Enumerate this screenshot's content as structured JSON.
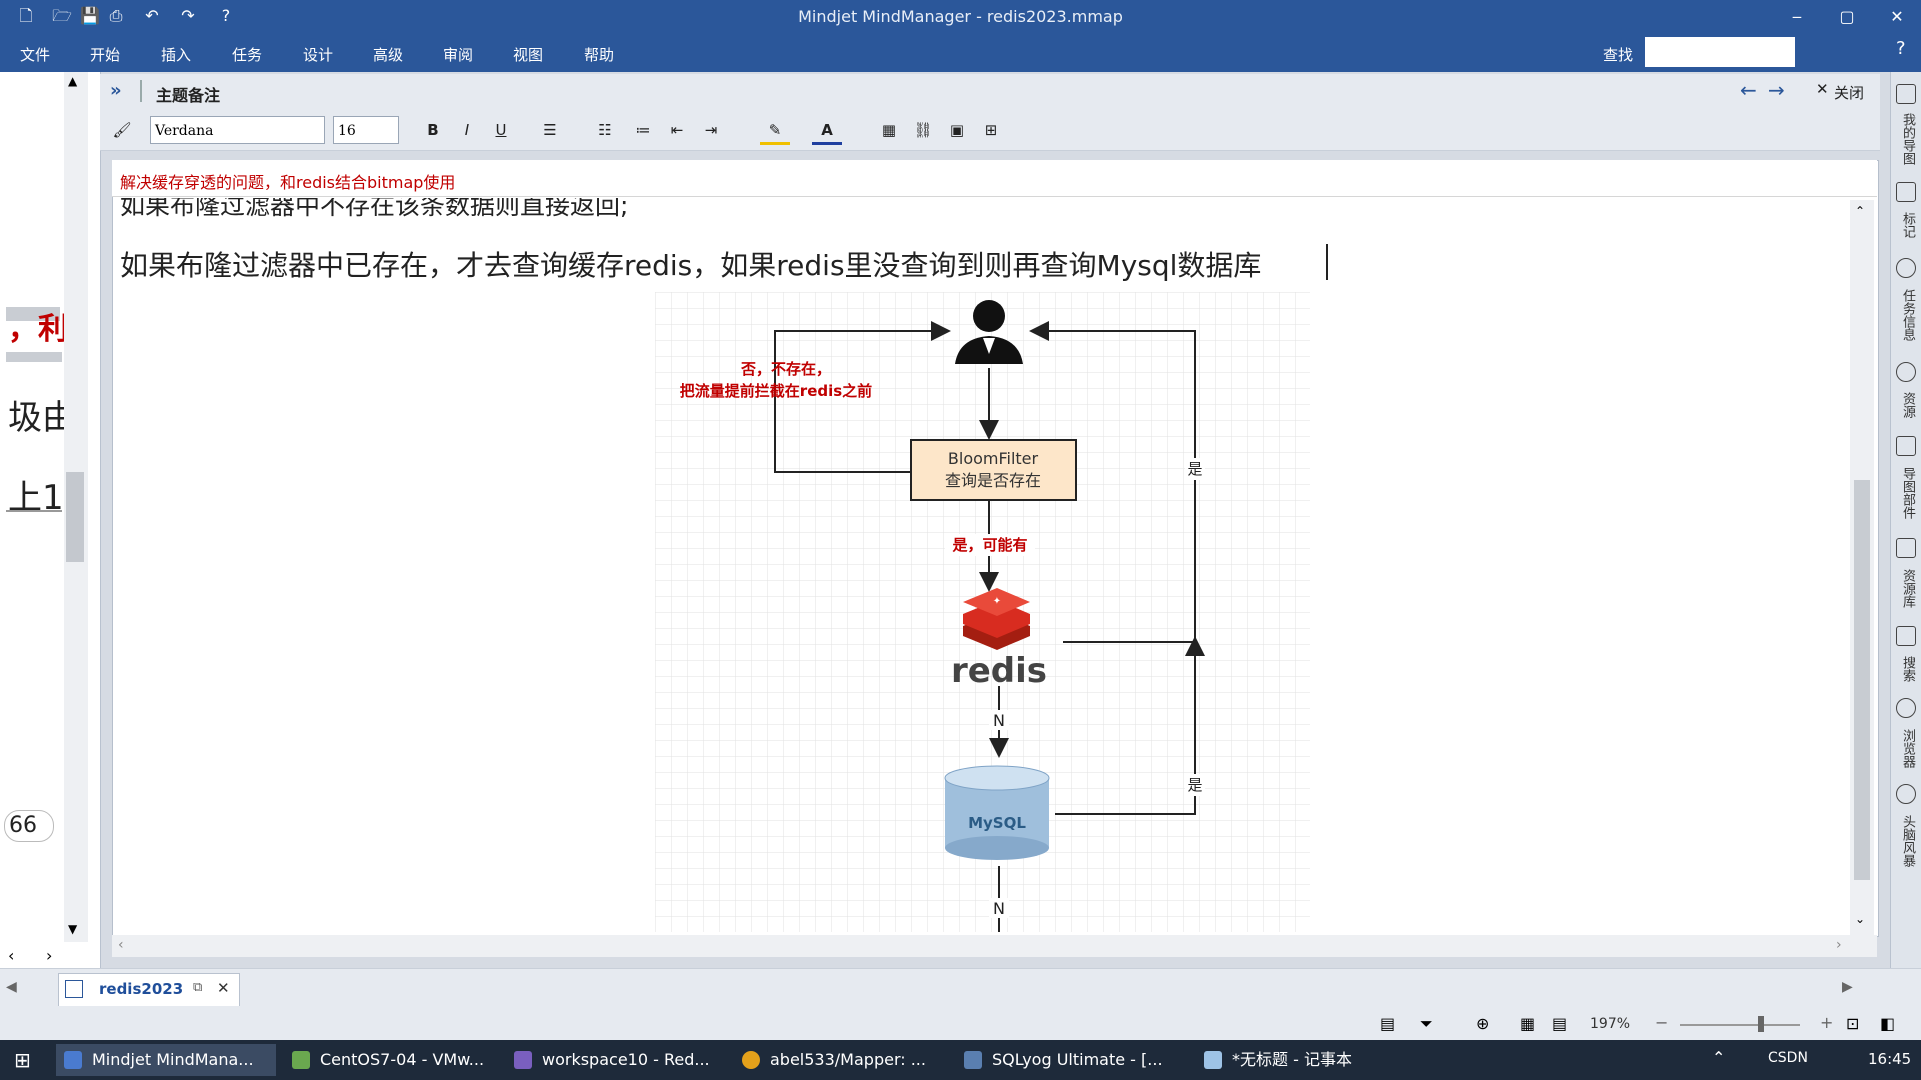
{
  "window": {
    "title": "Mindjet MindManager - redis2023.mmap",
    "minimize": "‒",
    "maximize": "▢",
    "close": "✕"
  },
  "menu": [
    "文件",
    "开始",
    "插入",
    "任务",
    "设计",
    "高级",
    "审阅",
    "视图",
    "帮助"
  ],
  "search_label": "查找",
  "notes": {
    "header": "主题备注",
    "close_label": "关闭",
    "font_name": "Verdana",
    "font_size": "16",
    "red_line": "解决缓存穿透的问题，和redis结合bitmap使用",
    "cut_line": "如果布隆过滤器中不存在该条数据则直接返回;",
    "main_line": "如果布隆过滤器中已存在，才去查询缓存redis，如果redis里没查询到则再查询Mysql数据库"
  },
  "diagram": {
    "no_label_line1": "否，不存在，",
    "no_label_line2": "把流量提前拦截在redis之前",
    "bloom_line1": "BloomFilter",
    "bloom_line2": "查询是否存在",
    "yes_maybe": "是，可能有",
    "yes1": "是",
    "yes2": "是",
    "n1": "N",
    "n2": "N",
    "redis_text": "redis",
    "mysql_text": "MySQL"
  },
  "left_panel": {
    "frag1": "，利",
    "frag2": "圾由",
    "frag3": "上1",
    "frag4": "66"
  },
  "right_dock": [
    "我的导图",
    "标记",
    "任务信息",
    "资源",
    "导图部件",
    "资源库",
    "搜索",
    "浏览器",
    "头脑风暴"
  ],
  "tab": {
    "name": "redis2023"
  },
  "status": {
    "zoom": "197%"
  },
  "taskbar": {
    "items": [
      "Mindjet MindMana...",
      "CentOS7-04 - VMw...",
      "workspace10 - Red...",
      "abel533/Mapper: ...",
      "SQLyog Ultimate - [...",
      "*无标题 - 记事本"
    ],
    "time": "16:45",
    "csdn": "CSDN"
  },
  "colors": {
    "title_bar": "#2b579a",
    "red_text": "#c00000",
    "bloom_fill": "#fde6c9",
    "redis_red": "#d82c20"
  }
}
